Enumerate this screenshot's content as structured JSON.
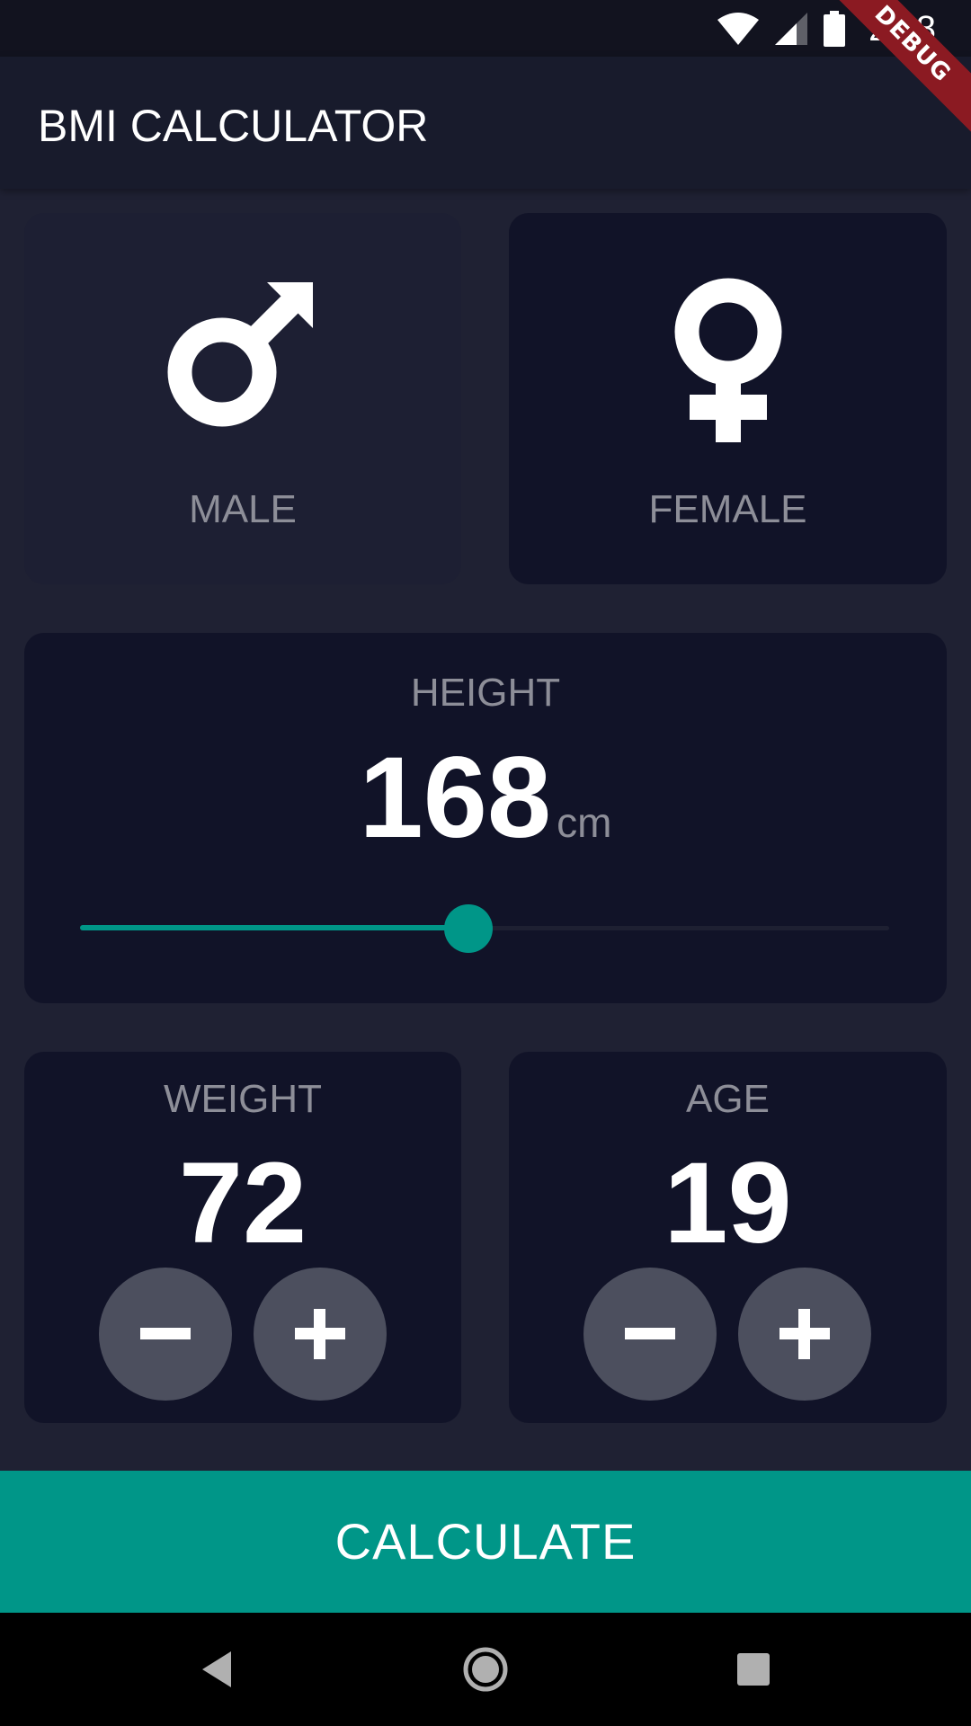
{
  "status": {
    "time": "2:18"
  },
  "debug_banner": "DEBUG",
  "app_bar": {
    "title": "BMI CALCULATOR"
  },
  "gender": {
    "male_label": "MALE",
    "female_label": "FEMALE",
    "selected": "male"
  },
  "height": {
    "label": "HEIGHT",
    "value": "168",
    "unit": "cm",
    "slider_fraction": 0.48
  },
  "weight": {
    "label": "WEIGHT",
    "value": "72"
  },
  "age": {
    "label": "AGE",
    "value": "19"
  },
  "calculate_label": "CALCULATE",
  "colors": {
    "background": "#1f2133",
    "card": "#111328",
    "accent": "#009688",
    "inactive_text": "#8d8e98",
    "button": "#4c4f5e"
  },
  "icons": {
    "male": "mars-icon",
    "female": "venus-icon",
    "minus": "minus-icon",
    "plus": "plus-icon",
    "wifi": "wifi-icon",
    "signal": "cell-signal-icon",
    "battery": "battery-icon",
    "back": "back-icon",
    "home": "home-icon",
    "recents": "recents-icon"
  }
}
